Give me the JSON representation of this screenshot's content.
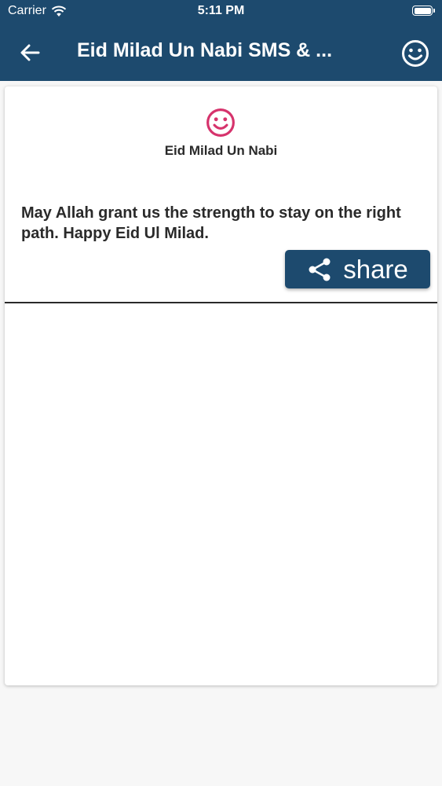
{
  "status_bar": {
    "carrier": "Carrier",
    "time": "5:11 PM"
  },
  "toolbar": {
    "title": "Eid Milad Un Nabi SMS & ...",
    "back_icon": "arrow-left-icon",
    "action_icon": "smiley-icon"
  },
  "card": {
    "icon": "smiley-icon",
    "icon_color": "#d6336c",
    "title": "Eid Milad Un Nabi",
    "message": "May Allah grant us the strength to stay on the right path. Happy Eid Ul Milad.",
    "share_label": "share",
    "share_icon": "share-icon"
  },
  "colors": {
    "primary": "#1d4a6e",
    "accent": "#d6336c",
    "text": "#2a2a2a",
    "background": "#f7f7f7"
  }
}
